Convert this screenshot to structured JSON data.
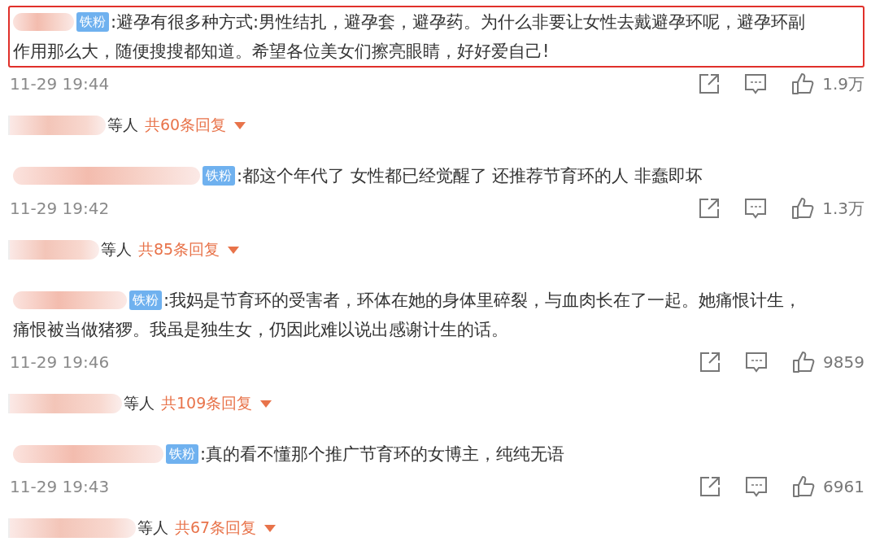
{
  "comments": [
    {
      "badge": "铁粉",
      "text_lines": [
        ":避孕有很多种方式:男性结扎，避孕套，避孕药。为什么非要让女性去戴避孕环呢，避孕环副",
        "作用那么大，随便搜搜都知道。希望各位美女们擦亮眼睛，好好爱自己!"
      ],
      "highlighted": true,
      "time": "11-29 19:44",
      "likes": "1.9万",
      "replies_prefix": "等人",
      "replies": "共60条回复"
    },
    {
      "badge": "铁粉",
      "text_lines": [
        ":都这个年代了 女性都已经觉醒了 还推荐节育环的人 非蠢即坏"
      ],
      "highlighted": false,
      "time": "11-29 19:42",
      "likes": "1.3万",
      "replies_prefix": "等人",
      "replies": "共85条回复"
    },
    {
      "badge": "铁粉",
      "text_lines": [
        ":我妈是节育环的受害者，环体在她的身体里碎裂，与血肉长在了一起。她痛恨计生，",
        "痛恨被当做猪猡。我虽是独生女，仍因此难以说出感谢计生的话。"
      ],
      "highlighted": false,
      "time": "11-29 19:46",
      "likes": "9859",
      "replies_prefix": "等人",
      "replies": "共109条回复"
    },
    {
      "badge": "铁粉",
      "text_lines": [
        ":真的看不懂那个推广节育环的女博主，纯纯无语"
      ],
      "highlighted": false,
      "time": "11-29 19:43",
      "likes": "6961",
      "replies_prefix": "等人",
      "replies": "共67条回复"
    }
  ]
}
